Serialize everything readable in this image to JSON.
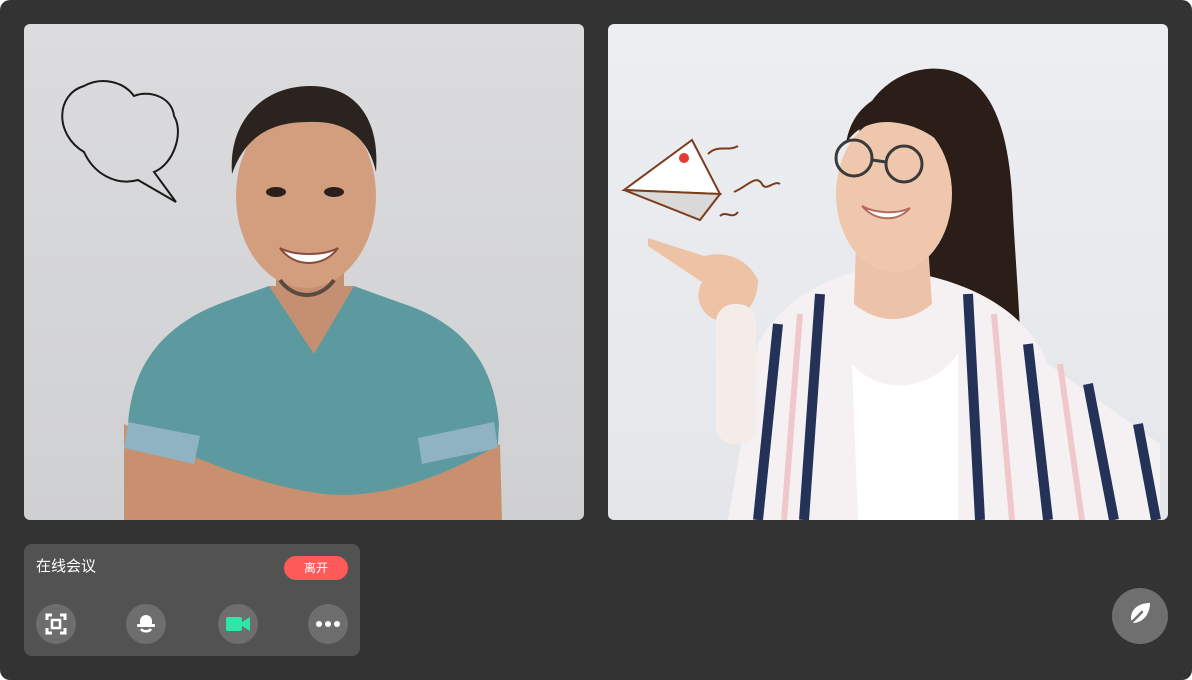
{
  "meeting": {
    "title": "在线会议",
    "leave_label": "离开"
  },
  "participants": [
    {
      "video": "man-in-teal-shirt"
    },
    {
      "video": "woman-in-striped-shirt"
    }
  ],
  "controls": {
    "items": [
      {
        "icon": "screen-capture-icon"
      },
      {
        "icon": "microphone-muted-icon"
      },
      {
        "icon": "video-camera-icon",
        "color": "#2ee6a8"
      },
      {
        "icon": "more-icon"
      }
    ]
  },
  "fab": {
    "icon": "leaf-icon"
  },
  "colors": {
    "background": "#333333",
    "panel": "#525252",
    "leave": "#ff5a5a",
    "camera_active": "#2ee6a8"
  }
}
